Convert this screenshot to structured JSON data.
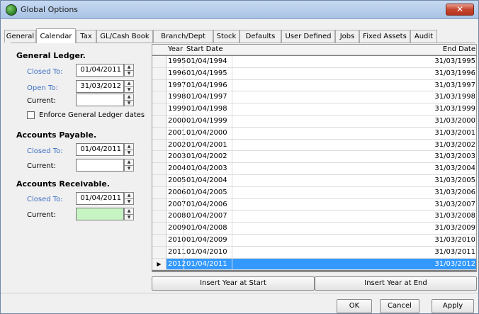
{
  "window": {
    "title": "Global Options",
    "close_label": "✕"
  },
  "tabs": [
    {
      "label": "General",
      "active": false
    },
    {
      "label": "Calendar",
      "active": true
    },
    {
      "label": "Tax",
      "active": false
    },
    {
      "label": "GL/Cash Book",
      "active": false
    },
    {
      "label": "Branch/Dept",
      "active": false
    },
    {
      "label": "Stock",
      "active": false
    },
    {
      "label": "Defaults",
      "active": false
    },
    {
      "label": "User Defined",
      "active": false
    },
    {
      "label": "Jobs",
      "active": false
    },
    {
      "label": "Fixed Assets",
      "active": false
    },
    {
      "label": "Audit",
      "active": false
    }
  ],
  "general_ledger": {
    "title": "General Ledger.",
    "closed_to_label": "Closed To:",
    "closed_to_value": "01/04/2011",
    "open_to_label": "Open To:",
    "open_to_value": "31/03/2012",
    "current_label": "Current:",
    "current_value": "",
    "enforce_label": "Enforce General Ledger dates",
    "enforce_checked": false
  },
  "accounts_payable": {
    "title": "Accounts Payable.",
    "closed_to_label": "Closed To:",
    "closed_to_value": "01/04/2011",
    "current_label": "Current:",
    "current_value": ""
  },
  "accounts_receivable": {
    "title": "Accounts Receivable.",
    "closed_to_label": "Closed To:",
    "closed_to_value": "01/04/2011",
    "current_label": "Current:",
    "current_value": ""
  },
  "grid": {
    "columns": [
      "Year",
      "Start Date",
      "End Date"
    ],
    "rows": [
      [
        "1995",
        "01/04/1994",
        "31/03/1995"
      ],
      [
        "1996",
        "01/04/1995",
        "31/03/1996"
      ],
      [
        "1997",
        "01/04/1996",
        "31/03/1997"
      ],
      [
        "1998",
        "01/04/1997",
        "31/03/1998"
      ],
      [
        "1999",
        "01/04/1998",
        "31/03/1999"
      ],
      [
        "2000",
        "01/04/1999",
        "31/03/2000"
      ],
      [
        "2001",
        "01/04/2000",
        "31/03/2001"
      ],
      [
        "2002",
        "01/04/2001",
        "31/03/2002"
      ],
      [
        "2003",
        "01/04/2002",
        "31/03/2003"
      ],
      [
        "2004",
        "01/04/2003",
        "31/03/2004"
      ],
      [
        "2005",
        "01/04/2004",
        "31/03/2005"
      ],
      [
        "2006",
        "01/04/2005",
        "31/03/2006"
      ],
      [
        "2007",
        "01/04/2006",
        "31/03/2007"
      ],
      [
        "2008",
        "01/04/2007",
        "31/03/2008"
      ],
      [
        "2009",
        "01/04/2008",
        "31/03/2009"
      ],
      [
        "2010",
        "01/04/2009",
        "31/03/2010"
      ],
      [
        "2011",
        "01/04/2010",
        "31/03/2011"
      ],
      [
        "2012",
        "01/04/2011",
        "31/03/2012"
      ]
    ],
    "selected_year": "2012"
  },
  "buttons": {
    "insert_start": "Insert Year at Start",
    "insert_end": "Insert Year at End",
    "ok": "OK",
    "cancel": "Cancel",
    "apply": "Apply"
  },
  "colors": {
    "selected_row": "#3399ff",
    "label_blue": "#3c6fc4",
    "current_green": "#c6f4c3"
  }
}
